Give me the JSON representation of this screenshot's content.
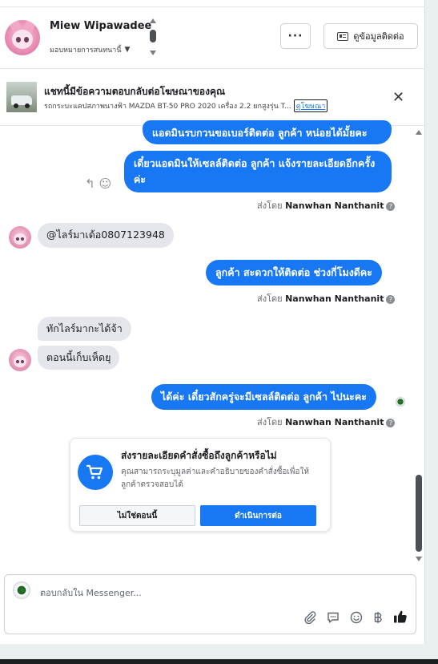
{
  "header": {
    "name": "Miew Wipawadee",
    "assign_label": "มอบหมายการสนทนานี้",
    "more_label": "···",
    "contact_button": "ดูข้อมูลติดต่อ"
  },
  "ad": {
    "title": "แชทนี้มีข้อความตอบกลับต่อโฆษณาของคุณ",
    "description": "รถกระบะแคปสภาพนางฟ้า MAZDA BT-50 PRO 2020 เครื่อง 2.2 ยกสูงรุ่น T...",
    "link": "ดูโฆษณา",
    "close": "✕"
  },
  "messages": {
    "m1": "แอดมินรบกวนขอเบอร์ติดต่อ ลูกค้า หน่อยได้มั้ยคะ",
    "m2": "เดี๋ยวแอดมินให้เซลล์ติดต่อ ลูกค้า แจ้งรายละเอียดอีกครั้ง ค่ะ",
    "m3": "@ไลร์มาเด้อ0807123948",
    "m4": "ลูกค้า สะดวกให้ติดต่อ ช่วงกี่โมงดีคะ",
    "m5": "ทักไลร์มากะได้จ้า",
    "m6": "ตอนนี้เก็บเห็ดยุ",
    "m7": "ได้ค่ะ  เดี๋ยวสักครู่จะมีเซลล์ติดต่อ ลูกค้า ไปนะคะ",
    "sent_by_label": "ส่งโดย",
    "sent_by_name": "Nanwhan Nanthanit",
    "info_mark": "?"
  },
  "order_card": {
    "title": "ส่งรายละเอียดคำสั่งซื้อถึงลูกค้าหรือไม่",
    "description": "คุณสามารถระบุมูลค่าและคำอธิบายของคำสั่งซื้อเพื่อให้ลูกค้าตรวจสอบได้",
    "decline": "ไม่ใช่ตอนนี้",
    "continue": "ดำเนินการต่อ"
  },
  "composer": {
    "placeholder": "ตอบกลับใน Messenger..."
  },
  "colors": {
    "accent": "#1877f2",
    "incoming_bubble": "#e4e6eb"
  }
}
